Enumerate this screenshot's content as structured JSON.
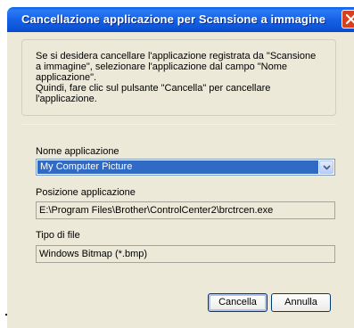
{
  "window": {
    "title": "Cancellazione applicazione per Scansione a immagine"
  },
  "description": "Se si desidera cancellare l'applicazione registrata da \"Scansione\na immagine\", selezionare l'applicazione dal campo \"Nome\napplicazione\".\nQuindi, fare clic sul pulsante \"Cancella\" per cancellare\nl'applicazione.",
  "fields": {
    "app_name_label": "Nome applicazione",
    "app_name_value": "My Computer Picture",
    "location_label": "Posizione applicazione",
    "location_value": "E:\\Program Files\\Brother\\ControlCenter2\\brctrcen.exe",
    "filetype_label": "Tipo di file",
    "filetype_value": "Windows Bitmap (*.bmp)"
  },
  "buttons": {
    "delete": "Cancella",
    "cancel": "Annulla"
  },
  "icons": {
    "close": "close-icon",
    "dropdown": "chevron-down-icon"
  },
  "colors": {
    "titlebar": "#0a5ee8",
    "selection": "#316ac5",
    "client": "#ece9d8",
    "close": "#d9401e"
  }
}
